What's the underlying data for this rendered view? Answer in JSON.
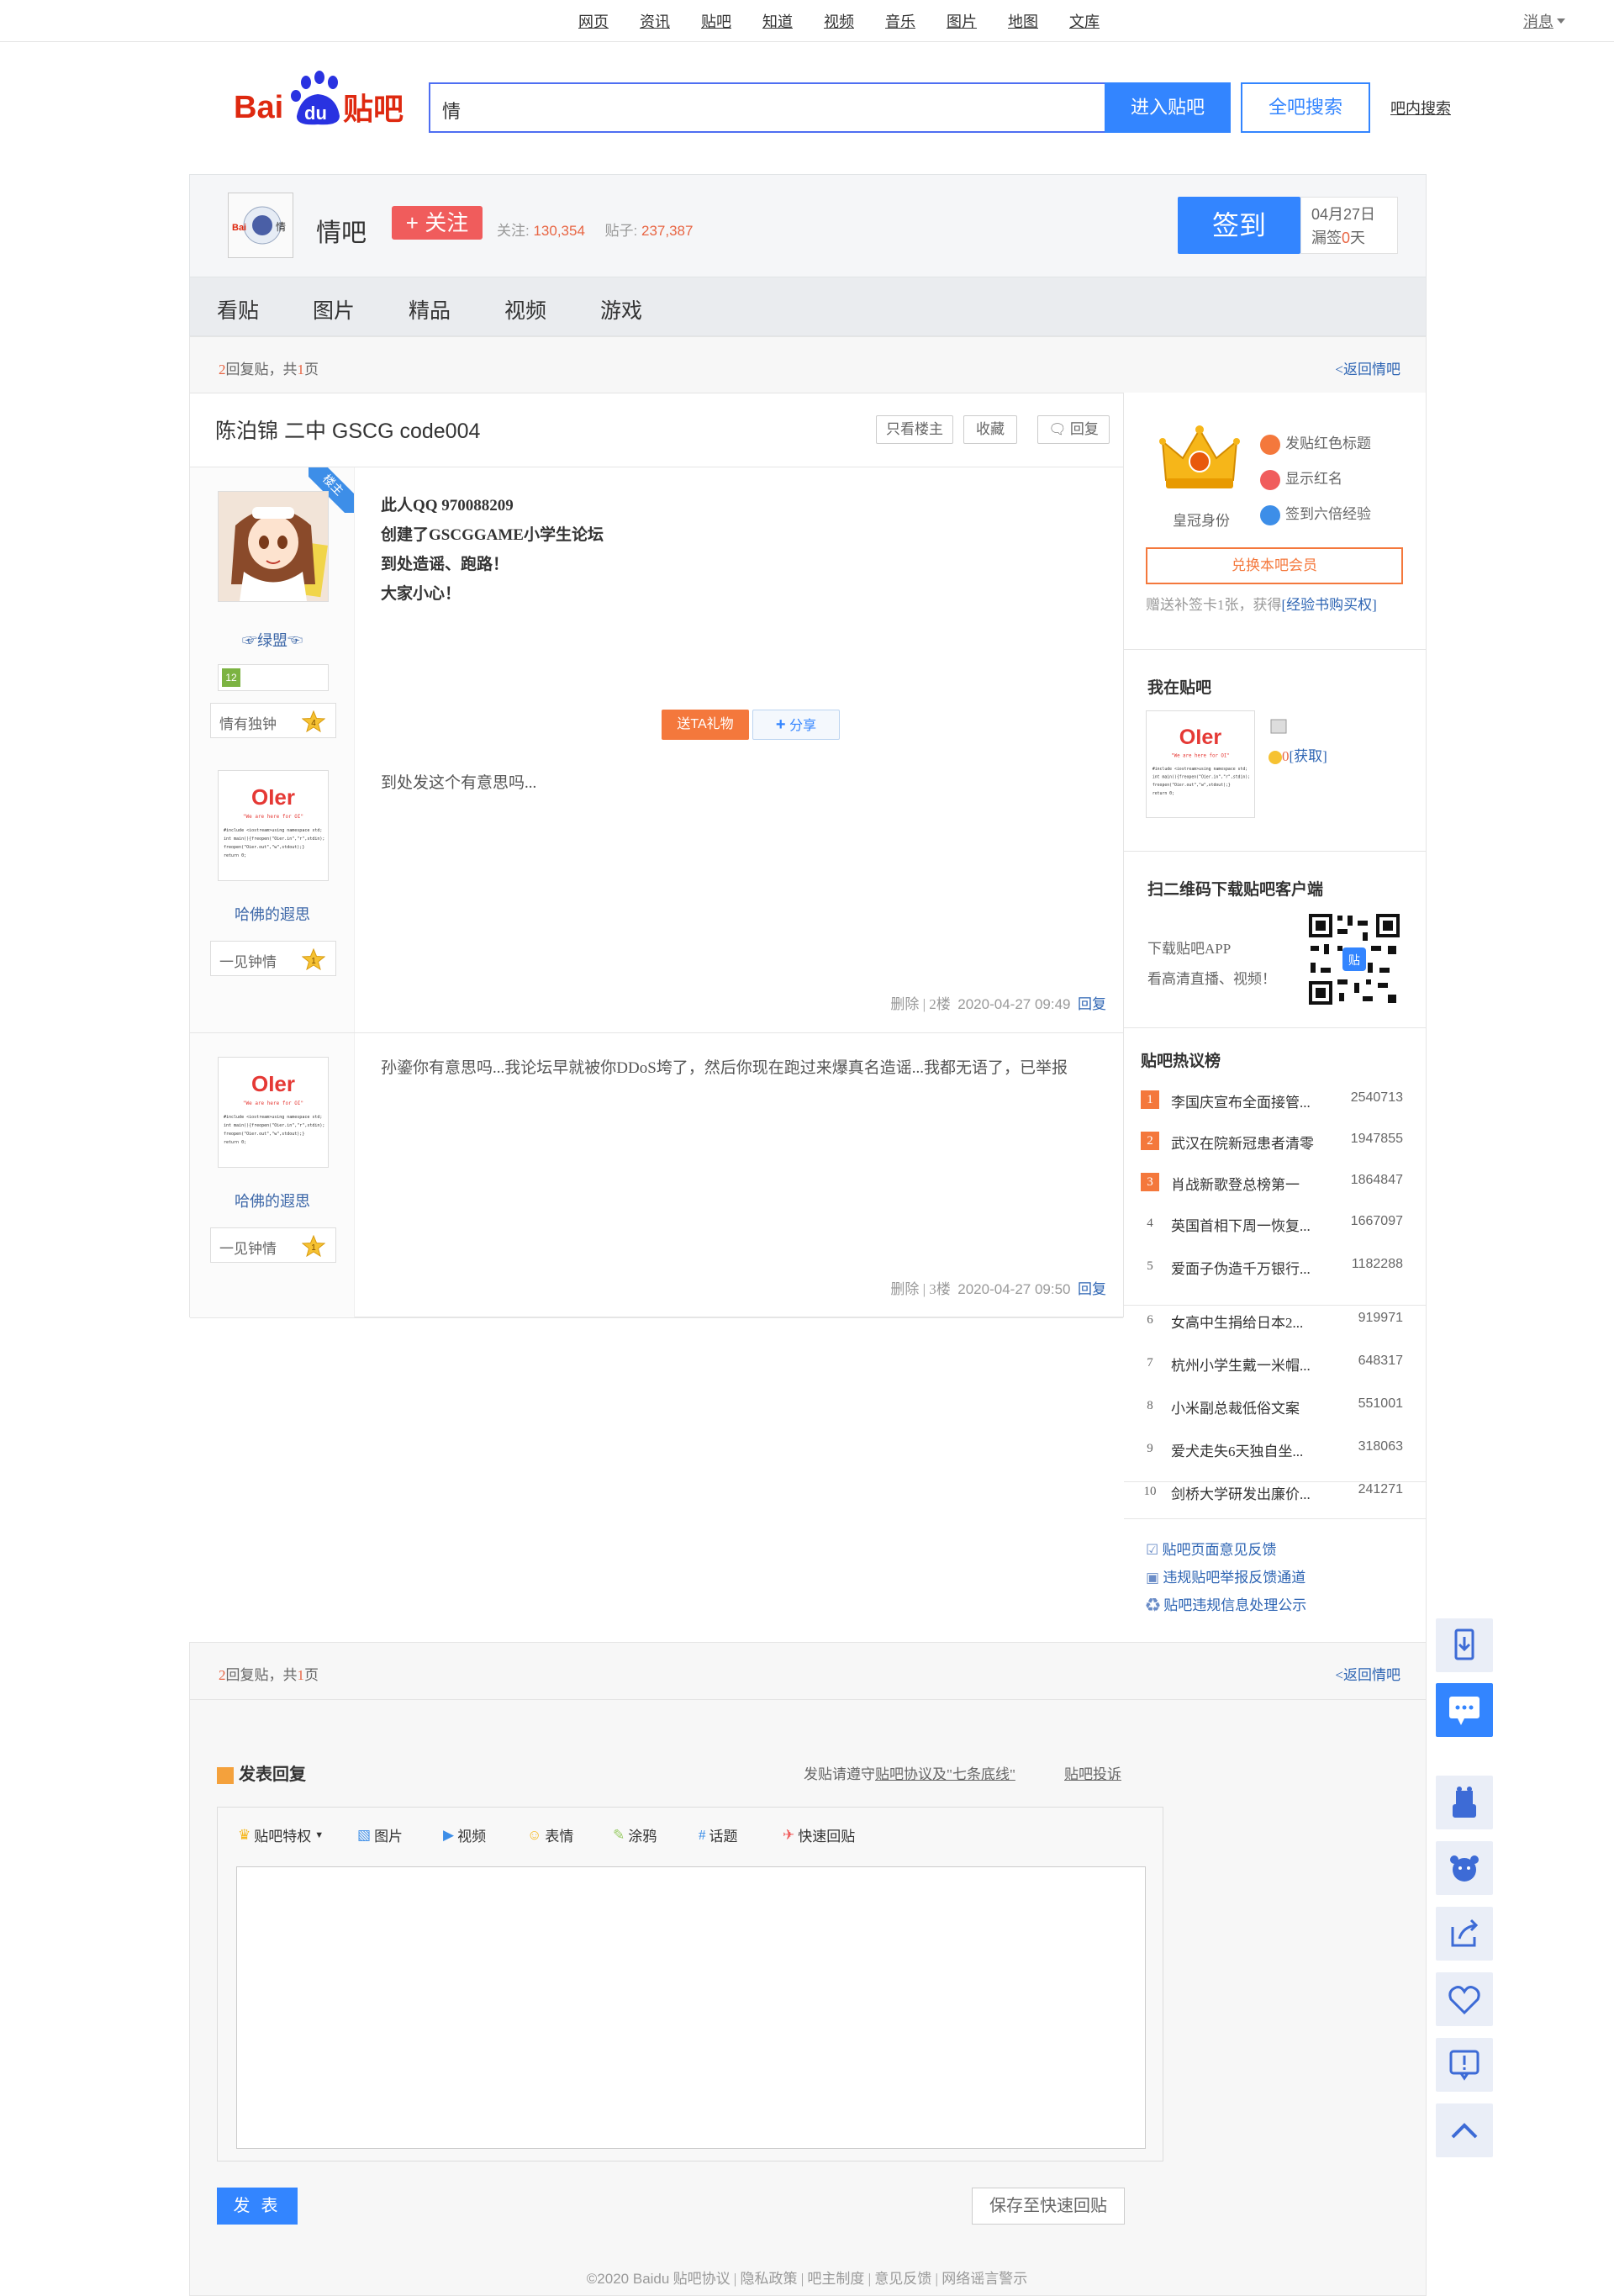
{
  "topnav": {
    "items": [
      "网页",
      "资讯",
      "贴吧",
      "知道",
      "视频",
      "音乐",
      "图片",
      "地图",
      "文库"
    ],
    "message": "消息"
  },
  "header": {
    "logo_text": "Baidu贴吧",
    "search_value": "情",
    "enter_button": "进入贴吧",
    "global_search_button": "全吧搜索",
    "in_bar_search": "吧内搜索"
  },
  "forum": {
    "name": "情吧",
    "follow_button": "+ 关注",
    "follow_label": "关注:",
    "follow_count": "130,354",
    "posts_label": "贴子:",
    "posts_count": "237,387",
    "signin_button": "签到",
    "sign_date": "04月27日",
    "sign_missed_prefix": "漏签",
    "sign_missed_count": "0",
    "sign_missed_suffix": "天"
  },
  "tabs": [
    "看贴",
    "图片",
    "精品",
    "视频",
    "游戏"
  ],
  "pager": {
    "reply_count": "2",
    "reply_label": "回复贴，共",
    "page_count": "1",
    "page_label": "页",
    "back": "<返回情吧"
  },
  "thread": {
    "title": "陈泊锦 二中 GSCG code004",
    "only_op": "只看楼主",
    "collect": "收藏",
    "reply": "回复"
  },
  "posts": [
    {
      "op_badge": "楼主",
      "user": "☞绿盟☜",
      "level_badge": "12",
      "rank_title": "情有独钟",
      "rank_level": "4",
      "lines": [
        "此人QQ 970088209",
        "创建了GSCGGAME小学生论坛",
        "到处造谣、跑路！",
        "大家小心！"
      ],
      "gift_button": "送TA礼物",
      "share_button": "分享",
      "second_user": "哈佛的遐思",
      "second_rank_title": "一见钟情",
      "second_rank_level": "1",
      "second_text": "到处发这个有意思吗...",
      "tail_delete": "删除",
      "tail_floor": "2楼",
      "tail_time": "2020-04-27 09:49",
      "tail_reply": "回复"
    },
    {
      "user": "哈佛的遐思",
      "rank_title": "一见钟情",
      "rank_level": "1",
      "text": "孙鎏你有意思吗...我论坛早就被你DDoS垮了，然后你现在跑过来爆真名造谣...我都无语了，已举报",
      "tail_delete": "删除",
      "tail_floor": "3楼",
      "tail_time": "2020-04-27 09:50",
      "tail_reply": "回复"
    }
  ],
  "avatar_image_text": {
    "title": "OIer",
    "subtitle": "\"We are here for OI\"",
    "code_lines": [
      "#include <iostream>using namespace std;",
      "int main(){freopen(\"Oier.in\",\"r\",stdin);",
      "freopen(\"Oier.out\",\"w\",stdout);}",
      "return 0;"
    ]
  },
  "sidebar": {
    "vip": {
      "crown_label": "皇冠身份",
      "perks": [
        "发贴红色标题",
        "显示红名",
        "签到六倍经验"
      ],
      "exchange_button": "兑换本吧会员",
      "gift_text": "赠送补签卡1张，获得",
      "gift_link": "[经验书购买权]"
    },
    "my_bar": {
      "title": "我在贴吧",
      "count": "0",
      "get": "[获取]"
    },
    "qr": {
      "title": "扫二维码下载贴吧客户端",
      "line1": "下载贴吧APP",
      "line2": "看高清直播、视频！"
    },
    "hot": {
      "title": "贴吧热议榜",
      "items": [
        {
          "idx": "1",
          "title": "李国庆宣布全面接管...",
          "count": "2540713"
        },
        {
          "idx": "2",
          "title": "武汉在院新冠患者清零",
          "count": "1947855"
        },
        {
          "idx": "3",
          "title": "肖战新歌登总榜第一",
          "count": "1864847"
        },
        {
          "idx": "4",
          "title": "英国首相下周一恢复...",
          "count": "1667097"
        },
        {
          "idx": "5",
          "title": "爱面子伪造千万银行...",
          "count": "1182288"
        },
        {
          "idx": "6",
          "title": "女高中生捐给日本2...",
          "count": "919971"
        },
        {
          "idx": "7",
          "title": "杭州小学生戴一米帽...",
          "count": "648317"
        },
        {
          "idx": "8",
          "title": "小米副总裁低俗文案",
          "count": "551001"
        },
        {
          "idx": "9",
          "title": "爱犬走失6天独自坐...",
          "count": "318063"
        },
        {
          "idx": "10",
          "title": "剑桥大学研发出廉价...",
          "count": "241271"
        }
      ]
    },
    "feedback": [
      "贴吧页面意见反馈",
      "违规贴吧举报反馈通道",
      "贴吧违规信息处理公示"
    ]
  },
  "reply_panel": {
    "title": "发表回复",
    "rules_prefix": "发贴请遵守",
    "rules_link": "贴吧协议及\"七条底线\"",
    "complain": "贴吧投诉",
    "tools": [
      "贴吧特权",
      "图片",
      "视频",
      "表情",
      "涂鸦",
      "话题",
      "快速回贴"
    ],
    "post_button": "发 表",
    "save_button": "保存至快速回贴"
  },
  "footer": {
    "copyright": "©2020 Baidu",
    "links": [
      "贴吧协议",
      "隐私政策",
      "吧主制度",
      "意见反馈",
      "网络谣言警示"
    ]
  },
  "colors": {
    "accent": "#3385ff",
    "red": "#e86543",
    "follow": "#f05c5c",
    "link": "#2d64b3"
  }
}
